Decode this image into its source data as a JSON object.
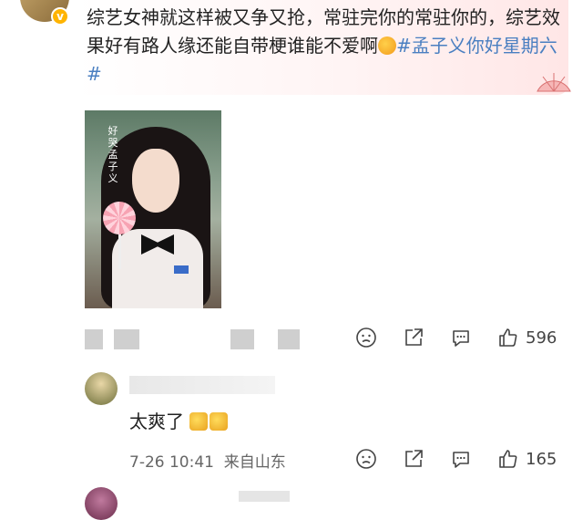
{
  "post": {
    "text": "综艺女神就这样被又争又抢，常驻完你的常驻你的，综艺效果好有路人缘还能自带梗谁能不爱啊",
    "hashtag": "#孟子义你好星期六#",
    "photo_vertical_text": "好 哭 孟 子 义",
    "likes": "596"
  },
  "reply": {
    "text": "太爽了",
    "timestamp": "7-26 10:41",
    "location": "来自山东",
    "likes": "165"
  },
  "colors": {
    "accent_link": "#4a7fc1",
    "verified_badge": "#ffb400",
    "bubble_tint": "#ffe6e6"
  },
  "icons": [
    "dislike-icon",
    "share-icon",
    "comment-icon",
    "like-icon"
  ]
}
